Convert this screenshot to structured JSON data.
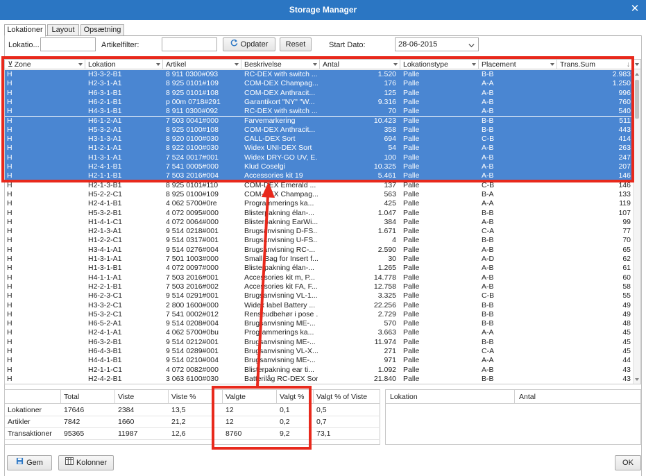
{
  "window": {
    "title": "Storage Manager",
    "close_glyph": "✕"
  },
  "tabs": [
    "Lokationer",
    "Layout",
    "Opsætning"
  ],
  "toolbar": {
    "lokation_label": "Lokatio...",
    "lokation_value": "",
    "artikelfilter_label": "Artikelfilter:",
    "artikelfilter_value": "",
    "opdater_label": "Opdater",
    "reset_label": "Reset",
    "startdato_label": "Start Dato:",
    "startdato_value": "28-06-2015"
  },
  "grid": {
    "columns": [
      "Zone",
      "Lokation",
      "Artikel",
      "Beskrivelse",
      "Antal",
      "Lokationstype",
      "Placement",
      "Trans.Sum"
    ],
    "filter_glyph": "⊻",
    "sort_glyph": "↓",
    "selection_color": "#4a86d2",
    "rows": [
      [
        "H",
        "H3-3-2-B1",
        "8 911 0300#093",
        "RC-DEX with switch ...",
        "1.520",
        "Palle",
        "B-B",
        "2.983"
      ],
      [
        "H",
        "H2-3-1-A1",
        "8 925 0101#109",
        "COM-DEX Champag...",
        "176",
        "Palle",
        "A-A",
        "1.250"
      ],
      [
        "H",
        "H6-3-1-B1",
        "8 925 0101#108",
        "COM-DEX Anthracit...",
        "125",
        "Palle",
        "A-B",
        "996"
      ],
      [
        "H",
        "H6-2-1-B1",
        "p 00m 0718#291",
        "Garantikort \"NY\" \"W...",
        "9.316",
        "Palle",
        "A-B",
        "760"
      ],
      [
        "H",
        "H4-3-1-B1",
        "8 911 0300#092",
        "RC-DEX with switch ...",
        "70",
        "Palle",
        "A-B",
        "540"
      ],
      [
        "H",
        "H6-1-2-A1",
        "7 503 0041#000",
        "Farvemarkering",
        "10.423",
        "Palle",
        "B-B",
        "511"
      ],
      [
        "H",
        "H5-3-2-A1",
        "8 925 0100#108",
        "COM-DEX Anthracit...",
        "358",
        "Palle",
        "B-B",
        "443"
      ],
      [
        "H",
        "H3-1-3-A1",
        "8 920 0100#030",
        "CALL-DEX Sort",
        "694",
        "Palle",
        "C-B",
        "414"
      ],
      [
        "H",
        "H1-2-1-A1",
        "8 922 0100#030",
        "Widex UNI-DEX Sort",
        "54",
        "Palle",
        "A-B",
        "263"
      ],
      [
        "H",
        "H1-3-1-A1",
        "7 524 0017#001",
        "Widex DRY-GO UV, E...",
        "100",
        "Palle",
        "A-B",
        "247"
      ],
      [
        "H",
        "H2-4-1-B1",
        "7 541 0005#000",
        "Klud Coselgi",
        "10.325",
        "Palle",
        "A-B",
        "207"
      ],
      [
        "H",
        "H2-1-1-B1",
        "7 503 2016#004",
        "Accessories kit 19",
        "5.461",
        "Palle",
        "A-B",
        "146"
      ],
      [
        "H",
        "H2-1-3-B1",
        "8 925 0101#110",
        "COM-DEX Emerald ...",
        "137",
        "Palle",
        "C-B",
        "146"
      ],
      [
        "H",
        "H5-2-2-C1",
        "8 925 0100#109",
        "COM-DEX Champag...",
        "563",
        "Palle",
        "B-A",
        "133"
      ],
      [
        "H",
        "H2-4-1-B1",
        "4 062 5700#0re",
        "Programmerings ka...",
        "425",
        "Palle",
        "A-A",
        "119"
      ],
      [
        "H",
        "H5-3-2-B1",
        "4 072 0095#000",
        "Blisterpakning élan-...",
        "1.047",
        "Palle",
        "B-B",
        "107"
      ],
      [
        "H",
        "H1-4-1-C1",
        "4 072 0064#000",
        "Blisterpakning EarWi...",
        "384",
        "Palle",
        "A-B",
        "99"
      ],
      [
        "H",
        "H2-1-3-A1",
        "9 514 0218#001",
        "Brugsanvisning D-FS...",
        "1.671",
        "Palle",
        "C-A",
        "77"
      ],
      [
        "H",
        "H1-2-2-C1",
        "9 514 0317#001",
        "Brugsanvisning U-FS...",
        "4",
        "Palle",
        "B-B",
        "70"
      ],
      [
        "H",
        "H3-4-1-A1",
        "9 514 0276#004",
        "Brugsanvisning RC-...",
        "2.590",
        "Palle",
        "A-B",
        "65"
      ],
      [
        "H",
        "H1-3-1-A1",
        "7 501 1003#000",
        "Small Bag for Insert f...",
        "30",
        "Palle",
        "A-D",
        "62"
      ],
      [
        "H",
        "H1-3-1-B1",
        "4 072 0097#000",
        "Blisterpakning élan-...",
        "1.265",
        "Palle",
        "A-B",
        "61"
      ],
      [
        "H",
        "H4-1-1-A1",
        "7 503 2016#001",
        "Accessories kit m, P...",
        "14.778",
        "Palle",
        "A-B",
        "60"
      ],
      [
        "H",
        "H2-2-1-B1",
        "7 503 2016#002",
        "Accessories kit FA, F...",
        "12.758",
        "Palle",
        "A-B",
        "58"
      ],
      [
        "H",
        "H6-2-3-C1",
        "9 514 0291#001",
        "Brugsanvisning VL-1...",
        "3.325",
        "Palle",
        "C-B",
        "55"
      ],
      [
        "H",
        "H3-3-2-C1",
        "2 800 1600#000",
        "Widex label Battery ...",
        "22.256",
        "Palle",
        "B-B",
        "49"
      ],
      [
        "H",
        "H5-3-2-C1",
        "7 541 0002#012",
        "Renseudbehør i pose ...",
        "2.729",
        "Palle",
        "B-B",
        "49"
      ],
      [
        "H",
        "H6-5-2-A1",
        "9 514 0208#004",
        "Brugsanvisning ME-...",
        "570",
        "Palle",
        "B-B",
        "48"
      ],
      [
        "H",
        "H2-4-1-A1",
        "4 062 5700#0bu",
        "Programmerings ka...",
        "3.663",
        "Palle",
        "A-A",
        "45"
      ],
      [
        "H",
        "H6-3-2-B1",
        "9 514 0212#001",
        "Brugsanvisning ME-...",
        "11.974",
        "Palle",
        "B-B",
        "45"
      ],
      [
        "H",
        "H6-4-3-B1",
        "9 514 0289#001",
        "Brugsanvisning VL-X...",
        "271",
        "Palle",
        "C-A",
        "45"
      ],
      [
        "H",
        "H4-4-1-B1",
        "9 514 0210#004",
        "Brugsanvisning ME-...",
        "971",
        "Palle",
        "A-A",
        "44"
      ],
      [
        "H",
        "H2-1-1-C1",
        "4 072 0082#000",
        "Blisterpakning ear ti...",
        "1.092",
        "Palle",
        "A-B",
        "43"
      ],
      [
        "H",
        "H2-4-2-B1",
        "3 063 6100#030",
        "Batterilåg RC-DEX Sort",
        "21.840",
        "Palle",
        "B-B",
        "43"
      ]
    ],
    "selected_count": 12
  },
  "stats": {
    "headers": [
      "",
      "Total",
      "Viste",
      "Viste %",
      "Valgte",
      "Valgt %",
      "Valgt % of Viste"
    ],
    "rows": [
      [
        "Lokationer",
        "17646",
        "2384",
        "13,5",
        "12",
        "0,1",
        "0,5"
      ],
      [
        "Artikler",
        "7842",
        "1660",
        "21,2",
        "12",
        "0,2",
        "0,7"
      ],
      [
        "Transaktioner",
        "95365",
        "11987",
        "12,6",
        "8760",
        "9,2",
        "73,1"
      ]
    ]
  },
  "location_panel": {
    "headers": [
      "Lokation",
      "Antal"
    ]
  },
  "footer": {
    "gem_label": "Gem",
    "kolonner_label": "Kolonner",
    "ok_label": "OK"
  },
  "annotation_color": "#e8291c"
}
